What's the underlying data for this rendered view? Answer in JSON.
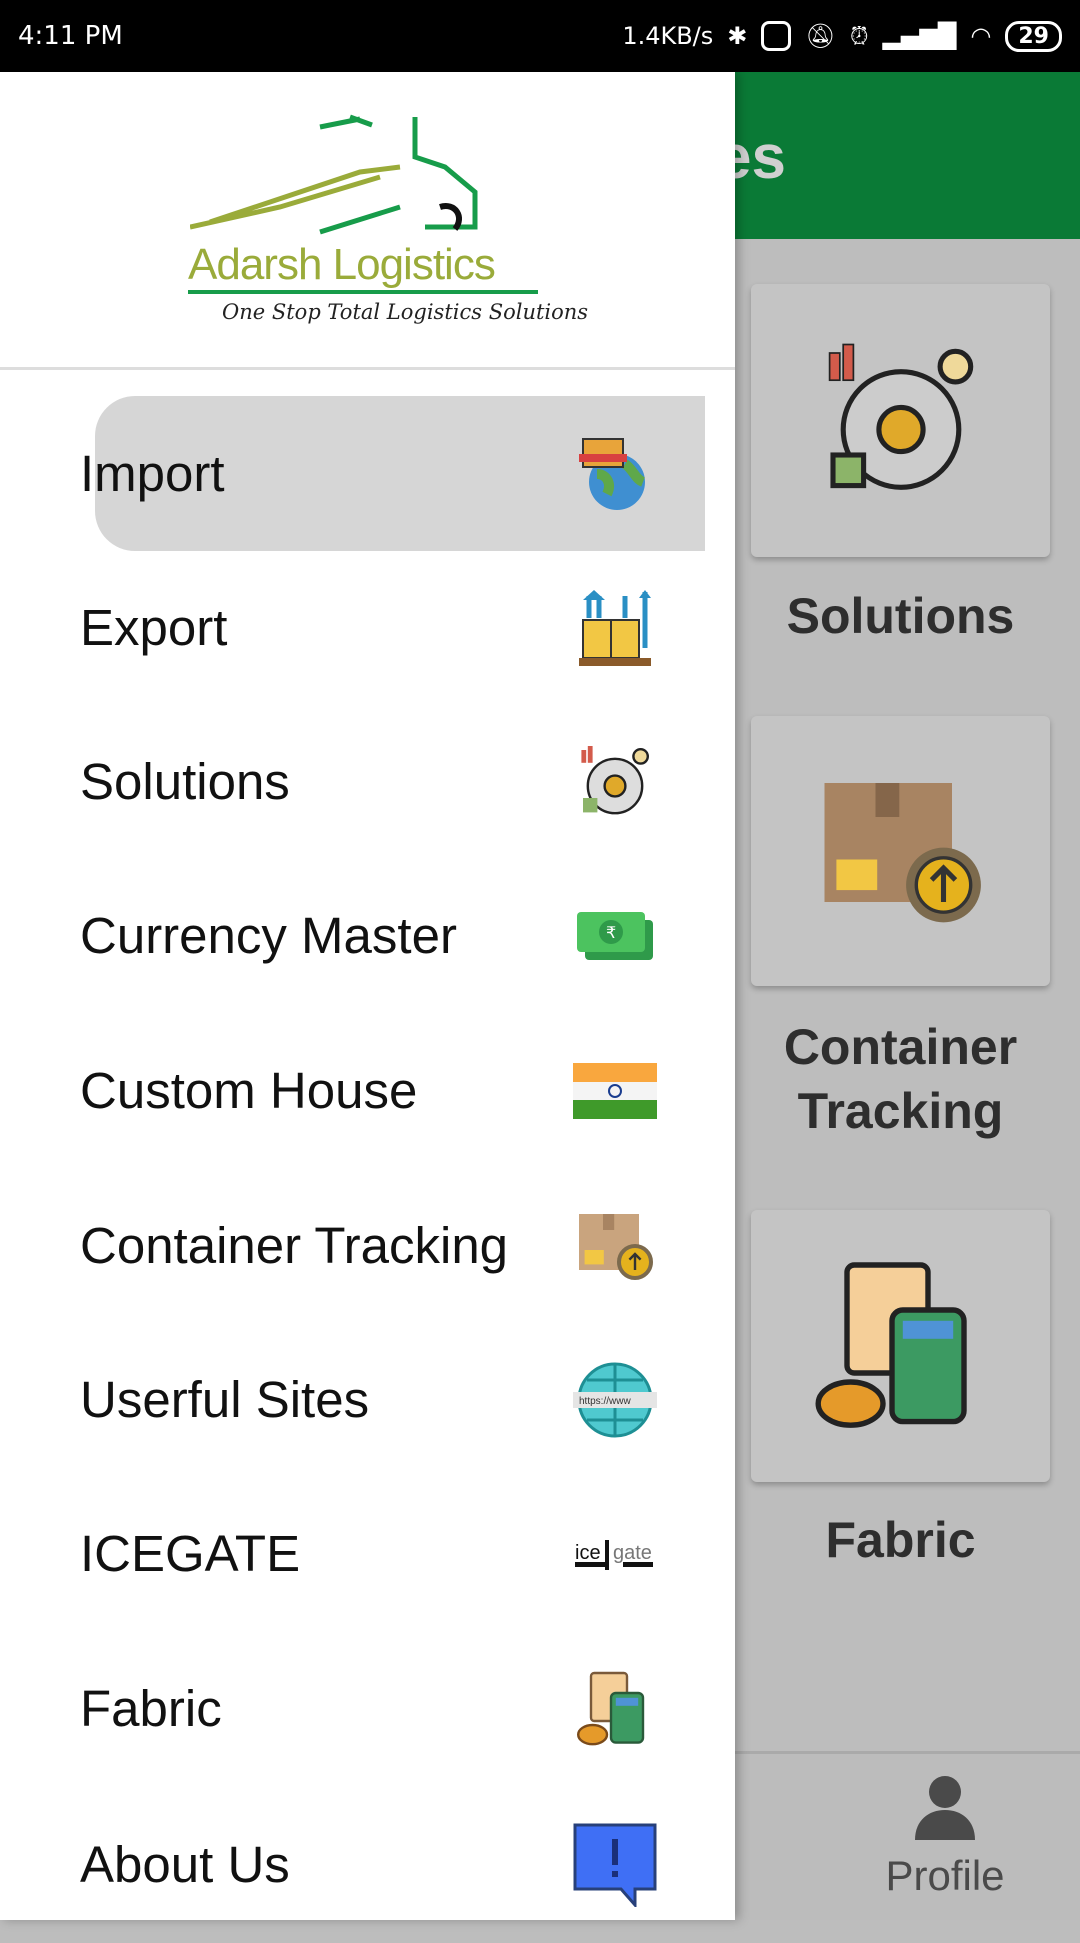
{
  "status_bar": {
    "time": "4:11 PM",
    "speed": "1.4KB/s",
    "battery": "29"
  },
  "background": {
    "title_fragment": "es",
    "header_color": "#0a7a36",
    "cards": [
      {
        "label": "Solutions"
      },
      {
        "label": "Container Tracking"
      },
      {
        "label": "Fabric"
      }
    ],
    "bottom_nav": {
      "profile_label": "Profile"
    }
  },
  "drawer": {
    "logo": {
      "name": "Adarsh Logistics",
      "tagline": "One Stop Total Logistics Solutions"
    },
    "items": [
      {
        "label": "Import",
        "icon": "globe-boxes-icon",
        "active": true
      },
      {
        "label": "Export",
        "icon": "pallet-arrows-icon"
      },
      {
        "label": "Solutions",
        "icon": "gear-chart-icon"
      },
      {
        "label": "Currency Master",
        "icon": "rupee-note-icon"
      },
      {
        "label": "Custom House",
        "icon": "india-flag-icon"
      },
      {
        "label": "Container Tracking",
        "icon": "box-upload-icon"
      },
      {
        "label": "Userful Sites",
        "icon": "www-globe-icon"
      },
      {
        "label": "ICEGATE",
        "icon": "icegate-logo-icon",
        "logo_text": "ice|gate"
      },
      {
        "label": "Fabric",
        "icon": "calculator-coins-icon"
      },
      {
        "label": "About Us",
        "icon": "info-chat-icon"
      }
    ]
  }
}
